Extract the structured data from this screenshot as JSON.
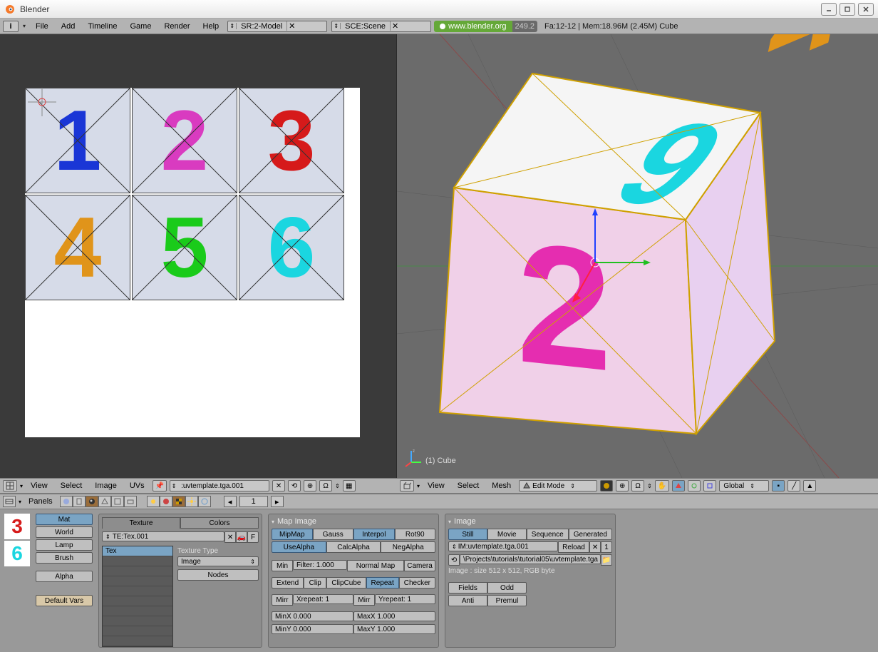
{
  "titlebar": {
    "title": "Blender"
  },
  "menubar": {
    "items": [
      "File",
      "Add",
      "Timeline",
      "Game",
      "Render",
      "Help"
    ],
    "screen_field": "SR:2-Model",
    "scene_field": "SCE:Scene",
    "link_text": "www.blender.org",
    "version": "249.2",
    "stats": "Fa:12-12 | Mem:18.96M (2.45M) Cube"
  },
  "uv": {
    "tiles": [
      {
        "num": "1",
        "color": "#1a36d6"
      },
      {
        "num": "2",
        "color": "#d93bc0"
      },
      {
        "num": "3",
        "color": "#d61a1a"
      },
      {
        "num": "4",
        "color": "#e0941a"
      },
      {
        "num": "5",
        "color": "#1acb1a"
      },
      {
        "num": "6",
        "color": "#1ad6e0"
      }
    ]
  },
  "uvheader": {
    "items": [
      "View",
      "Select",
      "Image",
      "UVs"
    ],
    "image_field": ":uvtemplate.tga.001"
  },
  "view3d": {
    "object_label": "(1) Cube",
    "header_items": [
      "View",
      "Select",
      "Mesh"
    ],
    "mode": "Edit Mode",
    "orientation": "Global"
  },
  "btnwin": {
    "panels_label": "Panels",
    "frame": "1"
  },
  "matpanel": {
    "tabs": [
      "Mat",
      "World",
      "Lamp",
      "Brush",
      "Alpha"
    ],
    "default_vars": "Default Vars"
  },
  "texpanel": {
    "tabs": [
      "Texture",
      "Colors"
    ],
    "te_field": "TE:Tex.001",
    "tex_slot": "Tex",
    "type_label": "Texture Type",
    "type_value": "Image",
    "nodes": "Nodes"
  },
  "mapimage": {
    "title": "Map Image",
    "row1": [
      "MipMap",
      "Gauss",
      "Interpol",
      "Rot90"
    ],
    "row2": [
      "UseAlpha",
      "CalcAlpha",
      "NegAlpha"
    ],
    "min": "Min",
    "filter": "Filter: 1.000",
    "normalmap": "Normal Map",
    "camera": "Camera",
    "rowext": [
      "Extend",
      "Clip",
      "ClipCube",
      "Repeat",
      "Checker"
    ],
    "mirr": "Mirr",
    "xrep": "Xrepeat: 1",
    "yrep": "Yrepeat: 1",
    "minx": "MinX 0.000",
    "maxx": "MaxX 1.000",
    "miny": "MinY 0.000",
    "maxy": "MaxY 1.000"
  },
  "imagepanel": {
    "title": "Image",
    "tabs": [
      "Still",
      "Movie",
      "Sequence",
      "Generated"
    ],
    "im_field": "IM:uvtemplate.tga.001",
    "reload": "Reload",
    "users": "1",
    "path": "\\Projects\\tutorials\\tutorial05\\uvtemplate.tga",
    "info": "Image : size 512 x 512, RGB byte",
    "fields": "Fields",
    "odd": "Odd",
    "anti": "Anti",
    "premul": "Premul"
  },
  "preview": {
    "three_color": "#d61a1a",
    "six_color": "#1ad6e0"
  }
}
